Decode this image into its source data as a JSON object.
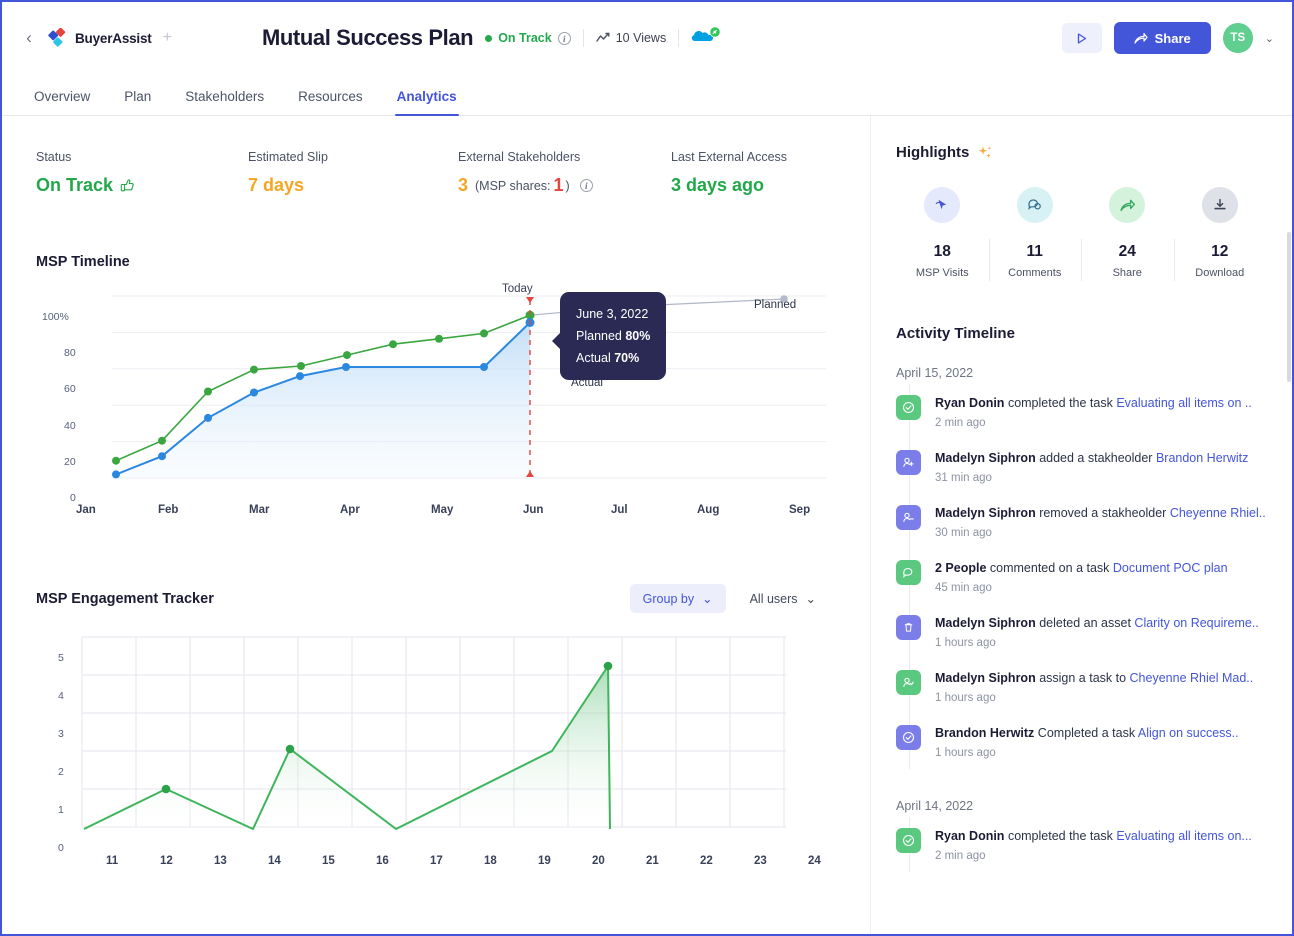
{
  "header": {
    "back_icon": "chevron-left-icon",
    "brand": "BuyerAssist",
    "plus": "+",
    "title": "Mutual Success Plan",
    "status": "On Track",
    "views": "10 Views",
    "integration_icon": "salesforce-link-icon",
    "play_icon": "play-icon",
    "share_label": "Share",
    "avatar_initials": "TS",
    "caret": "⌄"
  },
  "tabs": [
    {
      "label": "Overview",
      "active": false
    },
    {
      "label": "Plan",
      "active": false
    },
    {
      "label": "Stakeholders",
      "active": false
    },
    {
      "label": "Resources",
      "active": false
    },
    {
      "label": "Analytics",
      "active": true
    }
  ],
  "kpis": [
    {
      "label": "Status",
      "value": "On Track",
      "icon": "thumbs-up-icon"
    },
    {
      "label": "Estimated Slip",
      "value": "7 days"
    },
    {
      "label": "External Stakeholders",
      "value": "3",
      "sub_prefix": "(MSP shares:",
      "sub_count": "1",
      "sub_suffix": ")"
    },
    {
      "label": "Last External Access",
      "value": "3 days ago"
    }
  ],
  "timeline": {
    "title": "MSP Timeline",
    "today_label": "Today",
    "planned_legend": "Planned",
    "actual_legend": "Actual",
    "tooltip": {
      "date": "June 3, 2022",
      "planned_label": "Planned",
      "planned_value": "80%",
      "actual_label": "Actual",
      "actual_value": "70%"
    }
  },
  "engagement": {
    "title": "MSP Engagement Tracker",
    "group_by": "Group by",
    "all_users": "All users"
  },
  "highlights": {
    "title": "Highlights",
    "sparkle_icon": "sparkle-icon",
    "items": [
      {
        "value": "18",
        "label": "MSP Visits",
        "icon": "cursor-click-icon",
        "bg": "#e4e9fb",
        "fg": "#4355d9"
      },
      {
        "value": "11",
        "label": "Comments",
        "icon": "comment-icon",
        "bg": "#d8f1f4",
        "fg": "#2f6f8f"
      },
      {
        "value": "24",
        "label": "Share",
        "icon": "share-arrow-icon",
        "bg": "#d5f2dd",
        "fg": "#31a75b"
      },
      {
        "value": "12",
        "label": "Download",
        "icon": "download-icon",
        "bg": "#dfe1e8",
        "fg": "#3b4456"
      }
    ]
  },
  "activity": {
    "title": "Activity Timeline",
    "groups": [
      {
        "date": "April 15, 2022",
        "entries": [
          {
            "icon": "check-circle-icon",
            "color": "green",
            "actor": "Ryan Donin",
            "action": "completed the task",
            "link": "Evaluating all items on ..",
            "time": "2 min ago"
          },
          {
            "icon": "user-add-icon",
            "color": "purple",
            "actor": "Madelyn Siphron",
            "action": "added a stakheolder",
            "link": "Brandon Herwitz",
            "time": "31 min ago"
          },
          {
            "icon": "user-remove-icon",
            "color": "purple",
            "actor": "Madelyn Siphron",
            "action": "removed a stakheolder",
            "link": "Cheyenne Rhiel..",
            "time": "30 min ago"
          },
          {
            "icon": "comment-icon",
            "color": "green",
            "actor": "2 People",
            "action": "commented on a task",
            "link": "Document POC plan",
            "time": "45 min ago"
          },
          {
            "icon": "trash-icon",
            "color": "purple",
            "actor": "Madelyn Siphron",
            "action": "deleted an asset",
            "link": "Clarity on Requireme..",
            "time": "1 hours ago"
          },
          {
            "icon": "user-assign-icon",
            "color": "green",
            "actor": "Madelyn Siphron",
            "action": "assign a task to",
            "link": "Cheyenne Rhiel Mad..",
            "time": "1 hours ago"
          },
          {
            "icon": "check-circle-icon",
            "color": "purple",
            "actor": "Brandon Herwitz",
            "action": "Completed a task",
            "link": "Align on success..",
            "time": "1 hours ago"
          }
        ]
      },
      {
        "date": "April 14, 2022",
        "entries": [
          {
            "icon": "check-circle-icon",
            "color": "green",
            "actor": "Ryan Donin",
            "action": "completed the task",
            "link": "Evaluating all items on...",
            "time": "2 min ago"
          }
        ]
      }
    ]
  },
  "chart_data": [
    {
      "type": "line",
      "title": "MSP Timeline",
      "xlabel": "",
      "ylabel": "",
      "ylim": [
        0,
        100
      ],
      "yticks": [
        "0",
        "20",
        "40",
        "60",
        "80",
        "100%"
      ],
      "categories": [
        "Jan",
        "Feb",
        "Mar",
        "Apr",
        "May",
        "Jun",
        "Jul",
        "Aug",
        "Sep"
      ],
      "grid": true,
      "legend_position": "inline-right",
      "annotations": {
        "today_x": "Jun",
        "today_label": "Today",
        "tooltip_date": "June 3, 2022",
        "tooltip_planned": 80,
        "tooltip_actual": 70
      },
      "series": [
        {
          "name": "Planned",
          "color": "#2fa33f",
          "x": [
            0.0,
            0.5,
            1.0,
            1.5,
            2.0,
            2.5,
            3.0,
            3.5,
            4.0,
            5.0
          ],
          "values": [
            10,
            21,
            48,
            60,
            63,
            69,
            75,
            78,
            80,
            90
          ]
        },
        {
          "name": "Actual",
          "color": "#2b88e0",
          "x": [
            0.0,
            0.5,
            1.0,
            1.5,
            2.0,
            2.5,
            3.0,
            3.5,
            4.0,
            5.0
          ],
          "values": [
            2,
            12,
            33,
            47,
            56,
            61,
            61,
            61,
            61,
            86
          ]
        }
      ]
    },
    {
      "type": "area",
      "title": "MSP Engagement Tracker",
      "xlabel": "",
      "ylabel": "",
      "ylim": [
        0,
        5
      ],
      "yticks": [
        "0",
        "1",
        "2",
        "3",
        "4",
        "5"
      ],
      "categories": [
        "11",
        "12",
        "13",
        "14",
        "15",
        "16",
        "17",
        "18",
        "19",
        "20",
        "21",
        "22",
        "23",
        "24"
      ],
      "grid": true,
      "color": "#3fb55b",
      "x": [
        10.6,
        12.7,
        14.85,
        15.75,
        18.35,
        22.2,
        23.6,
        23.62
      ],
      "values": [
        0,
        1,
        0,
        2.1,
        0,
        1.9,
        4.25,
        0
      ],
      "markers": [
        {
          "x": 12.7,
          "y": 1
        },
        {
          "x": 15.75,
          "y": 2.1
        },
        {
          "x": 23.6,
          "y": 4.25
        }
      ]
    }
  ]
}
